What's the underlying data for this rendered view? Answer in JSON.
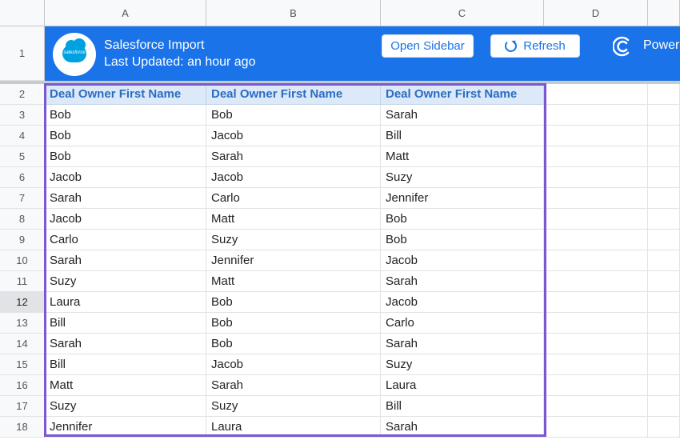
{
  "columns": [
    "A",
    "B",
    "C",
    "D"
  ],
  "banner": {
    "title": "Salesforce Import",
    "subtitle": "Last Updated: an hour ago",
    "logo_text": "salesforce",
    "open_sidebar_label": "Open Sidebar",
    "refresh_label": "Refresh",
    "power_label": "Power"
  },
  "banner_row": "1",
  "header_row": {
    "row": "2",
    "cells": [
      "Deal Owner First Name",
      "Deal Owner First Name",
      "Deal Owner First Name"
    ]
  },
  "rows": [
    {
      "row": "3",
      "cells": [
        "Bob",
        "Bob",
        "Sarah"
      ]
    },
    {
      "row": "4",
      "cells": [
        "Bob",
        "Jacob",
        "Bill"
      ]
    },
    {
      "row": "5",
      "cells": [
        "Bob",
        "Sarah",
        "Matt"
      ]
    },
    {
      "row": "6",
      "cells": [
        "Jacob",
        "Jacob",
        "Suzy"
      ]
    },
    {
      "row": "7",
      "cells": [
        "Sarah",
        "Carlo",
        "Jennifer"
      ]
    },
    {
      "row": "8",
      "cells": [
        "Jacob",
        "Matt",
        "Bob"
      ]
    },
    {
      "row": "9",
      "cells": [
        "Carlo",
        "Suzy",
        "Bob"
      ]
    },
    {
      "row": "10",
      "cells": [
        "Sarah",
        "Jennifer",
        "Jacob"
      ]
    },
    {
      "row": "11",
      "cells": [
        "Suzy",
        "Matt",
        "Sarah"
      ]
    },
    {
      "row": "12",
      "cells": [
        "Laura",
        "Bob",
        "Jacob"
      ]
    },
    {
      "row": "13",
      "cells": [
        "Bill",
        "Bob",
        "Carlo"
      ]
    },
    {
      "row": "14",
      "cells": [
        "Sarah",
        "Bob",
        "Sarah"
      ]
    },
    {
      "row": "15",
      "cells": [
        "Bill",
        "Jacob",
        "Suzy"
      ]
    },
    {
      "row": "16",
      "cells": [
        "Matt",
        "Sarah",
        "Laura"
      ]
    },
    {
      "row": "17",
      "cells": [
        "Suzy",
        "Suzy",
        "Bill"
      ]
    },
    {
      "row": "18",
      "cells": [
        "Jennifer",
        "Laura",
        "Sarah"
      ]
    }
  ],
  "selected_row": "12",
  "colors": {
    "banner": "#1a73e8",
    "header_fill": "#dbe9f8",
    "header_text": "#2b6cc4",
    "selection_border": "#7b57d1"
  },
  "icons": [
    "salesforce-logo",
    "refresh-icon",
    "coefficient-power-icon"
  ]
}
